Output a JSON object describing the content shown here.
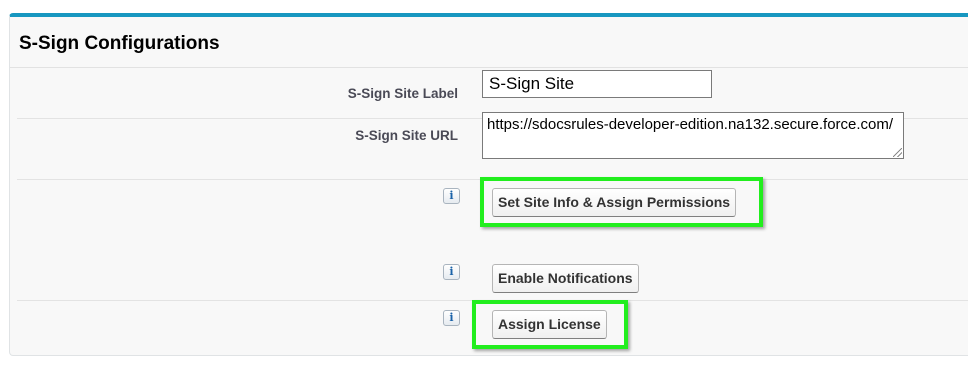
{
  "panel": {
    "title": "S-Sign Configurations",
    "accent_color": "#1797c0"
  },
  "fields": {
    "site_label": {
      "label": "S-Sign Site Label",
      "value": "S-Sign Site"
    },
    "site_url": {
      "label": "S-Sign Site URL",
      "value": "https://sdocsrules-developer-edition.na132.secure.force.com/"
    }
  },
  "actions": {
    "set_site_info": {
      "label": "Set Site Info & Assign Permissions",
      "highlighted": true
    },
    "enable_notifications": {
      "label": "Enable Notifications",
      "highlighted": false
    },
    "assign_license": {
      "label": "Assign License",
      "highlighted": true
    }
  },
  "icons": {
    "info_glyph": "i",
    "info_icon_name": "info-icon"
  },
  "highlight_color": "#22ee1e"
}
